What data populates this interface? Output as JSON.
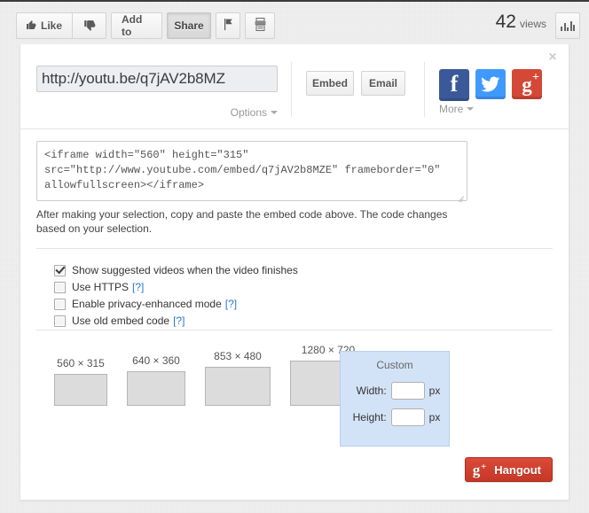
{
  "actionbar": {
    "like_label": "Like",
    "dislike_label": "",
    "add_to_label": "Add to",
    "share_label": "Share",
    "flag_label": "",
    "transcript_label": "",
    "views_count": "42",
    "views_label": "views",
    "stats_label": ""
  },
  "share": {
    "close_label": "×",
    "url_value": "http://youtu.be/q7jAV2b8MZE",
    "url_display": "http://youtu.be/q7jAV2b8MZ",
    "options_label": "Options",
    "embed_label": "Embed",
    "email_label": "Email",
    "more_label": "More",
    "social": [
      {
        "name": "facebook",
        "glyph": "f",
        "color": "#3b5998"
      },
      {
        "name": "twitter",
        "glyph": "",
        "color": "#4099ff"
      },
      {
        "name": "googleplus",
        "glyph": "g",
        "sup": "+",
        "color": "#d34836"
      }
    ]
  },
  "embed": {
    "code": "<iframe width=\"560\" height=\"315\" src=\"http://www.youtube.com/embed/q7jAV2b8MZE\" frameborder=\"0\" allowfullscreen></iframe>",
    "helper_text": "After making your selection, copy and paste the embed code above. The code changes based on your selection."
  },
  "options": [
    {
      "label": "Show suggested videos when the video finishes",
      "checked": true,
      "help": ""
    },
    {
      "label": "Use HTTPS",
      "checked": false,
      "help": "[?]"
    },
    {
      "label": "Enable privacy-enhanced mode",
      "checked": false,
      "help": "[?]"
    },
    {
      "label": "Use old embed code",
      "checked": false,
      "help": "[?]"
    }
  ],
  "sizes": [
    {
      "label": "560 × 315"
    },
    {
      "label": "640 × 360"
    },
    {
      "label": "853 × 480"
    },
    {
      "label": "1280 × 720"
    }
  ],
  "custom": {
    "title": "Custom",
    "width_label": "Width:",
    "width_value": "",
    "height_label": "Height:",
    "height_value": "",
    "unit": "px"
  },
  "hangout": {
    "label": "Hangout",
    "glyph": "g",
    "sup": "+",
    "color": "#c53727"
  }
}
